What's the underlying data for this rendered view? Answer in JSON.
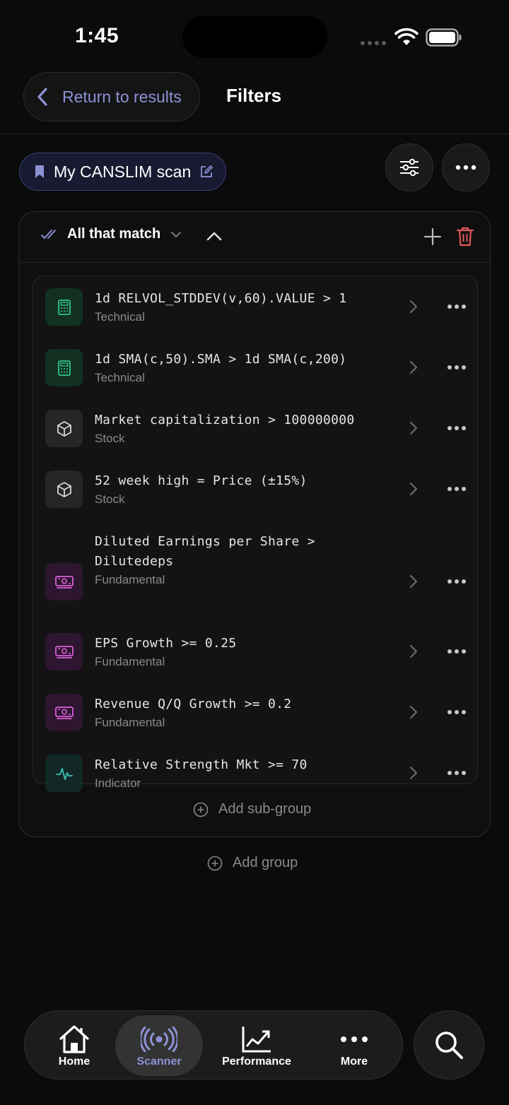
{
  "status_bar": {
    "time": "1:45"
  },
  "header": {
    "back_label": "Return to results",
    "title": "Filters"
  },
  "scan": {
    "name": "My CANSLIM scan"
  },
  "group": {
    "match_label": "All that match",
    "filters": [
      {
        "expression": "1d RELVOL_STDDEV(v,60).VALUE > 1",
        "category": "Technical",
        "icon": "calculator-icon",
        "color": "#33c38a",
        "bg": "#123123"
      },
      {
        "expression": "1d SMA(c,50).SMA > 1d SMA(c,200)",
        "category": "Technical",
        "icon": "calculator-icon",
        "color": "#33c38a",
        "bg": "#123123"
      },
      {
        "expression": "Market capitalization > 100000000",
        "category": "Stock",
        "icon": "cube-icon",
        "color": "#d8d8d8",
        "bg": "#262626"
      },
      {
        "expression": "52 week high = Price (±15%)",
        "category": "Stock",
        "icon": "cube-icon",
        "color": "#d8d8d8",
        "bg": "#262626"
      },
      {
        "expression": "Diluted Earnings per Share > Dilutedeps",
        "category": "Fundamental",
        "icon": "money-icon",
        "color": "#d660d6",
        "bg": "#2e1530"
      },
      {
        "expression": "EPS Growth >= 0.25",
        "category": "Fundamental",
        "icon": "money-icon",
        "color": "#d660d6",
        "bg": "#2e1530"
      },
      {
        "expression": "Revenue Q/Q Growth >= 0.2",
        "category": "Fundamental",
        "icon": "money-icon",
        "color": "#d660d6",
        "bg": "#2e1530"
      },
      {
        "expression": "Relative Strength Mkt >= 70",
        "category": "Indicator",
        "icon": "pulse-icon",
        "color": "#3fc4b4",
        "bg": "#112826"
      }
    ],
    "add_subgroup_label": "Add sub-group"
  },
  "add_group_label": "Add group",
  "tabs": [
    {
      "label": "Home",
      "icon": "home-icon"
    },
    {
      "label": "Scanner",
      "icon": "radar-icon",
      "active": true
    },
    {
      "label": "Performance",
      "icon": "chart-icon"
    },
    {
      "label": "More",
      "icon": "more-icon"
    }
  ],
  "colors": {
    "accent": "#8d92d6",
    "danger": "#e05a5a",
    "background": "#0b0b0b"
  }
}
